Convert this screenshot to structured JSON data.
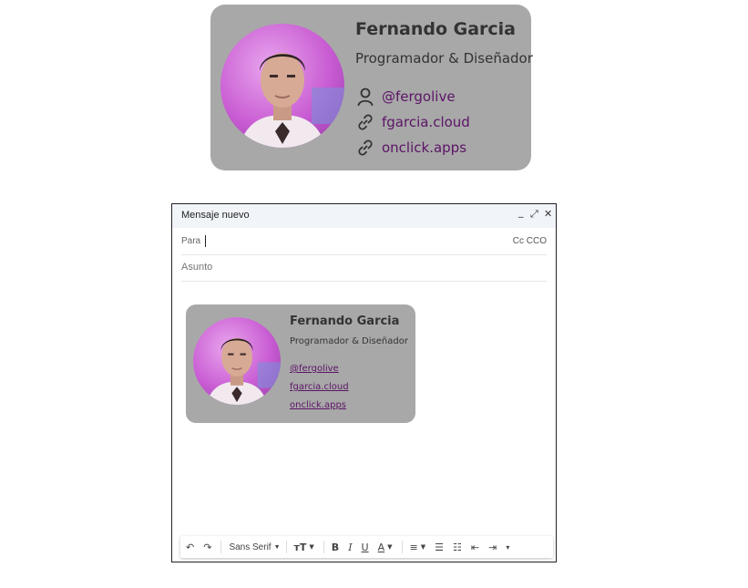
{
  "signature": {
    "name": "Fernando Garcia",
    "role": "Programador & Diseñador",
    "links": [
      {
        "icon": "user-icon",
        "text": "@fergolive"
      },
      {
        "icon": "link-icon",
        "text": "fgarcia.cloud"
      },
      {
        "icon": "link-icon",
        "text": "onclick.apps"
      }
    ],
    "card_color": "#a8a8a8",
    "link_color": "#5b1466"
  },
  "compose": {
    "title": "Mensaje nuevo",
    "minimize_icon": "_",
    "expand_icon": "⤢",
    "close_icon": "✕",
    "to_label": "Para",
    "cc_label": "Cc CCO",
    "subject_placeholder": "Asunto",
    "toolbar": {
      "undo": "↶",
      "redo": "↷",
      "font": "Sans Serif",
      "size": "тT",
      "bold": "B",
      "italic": "I",
      "underline": "U",
      "text_color": "A",
      "align": "≡",
      "numbered_list": "☰",
      "bullet_list": "☷",
      "indent_less": "⇤",
      "indent_more": "⇥",
      "more": "▾"
    }
  }
}
